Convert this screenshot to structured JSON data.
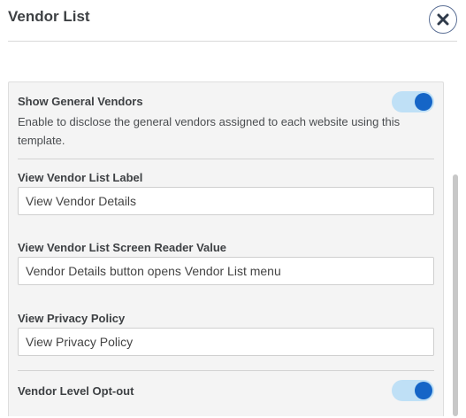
{
  "header": {
    "title": "Vendor List",
    "close_icon": "close-x-icon"
  },
  "settings": {
    "show_general_vendors": {
      "label": "Show General Vendors",
      "description": "Enable to disclose the general vendors assigned to each website using this template.",
      "enabled": true
    },
    "view_vendor_list_label": {
      "label": "View Vendor List Label",
      "value": "View Vendor Details"
    },
    "view_vendor_list_screen_reader_value": {
      "label": "View Vendor List Screen Reader Value",
      "value": "Vendor Details button opens Vendor List menu"
    },
    "view_privacy_policy": {
      "label": "View Privacy Policy",
      "value": "View Privacy Policy"
    },
    "vendor_level_opt_out": {
      "label": "Vendor Level Opt-out",
      "enabled": true
    }
  },
  "colors": {
    "toggle_on_track": "#bfe0f6",
    "toggle_on_knob": "#1565c7",
    "close_border": "#5b6f95"
  }
}
